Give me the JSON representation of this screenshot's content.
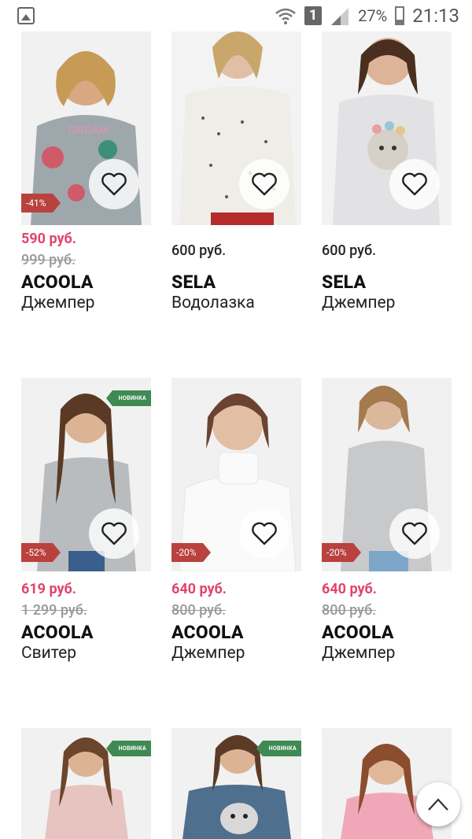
{
  "status_bar": {
    "battery": "27%",
    "time": "21:13",
    "sim": "1"
  },
  "products": [
    {
      "price": "590 руб.",
      "old_price": "999 руб.",
      "brand": "ACOOLA",
      "name": "Джемпер",
      "discount": "-41%",
      "badge": "",
      "sale": true
    },
    {
      "price": "600 руб.",
      "old_price": "",
      "brand": "SELA",
      "name": "Водолазка",
      "discount": "",
      "badge": "",
      "sale": false
    },
    {
      "price": "600 руб.",
      "old_price": "",
      "brand": "SELA",
      "name": "Джемпер",
      "discount": "",
      "badge": "",
      "sale": false
    },
    {
      "price": "619 руб.",
      "old_price": "1 299 руб.",
      "brand": "ACOOLA",
      "name": "Свитер",
      "discount": "-52%",
      "badge": "НОВИНКА",
      "sale": true
    },
    {
      "price": "640 руб.",
      "old_price": "800 руб.",
      "brand": "ACOOLA",
      "name": "Джемпер",
      "discount": "-20%",
      "badge": "",
      "sale": true
    },
    {
      "price": "640 руб.",
      "old_price": "800 руб.",
      "brand": "ACOOLA",
      "name": "Джемпер",
      "discount": "-20%",
      "badge": "",
      "sale": true
    },
    {
      "badge": "НОВИНКА"
    },
    {
      "badge": "НОВИНКА"
    },
    {
      "badge": ""
    }
  ],
  "colors": {
    "sale": "#e0456d",
    "discount_badge": "#b9423e",
    "new_badge": "#3f8a53"
  }
}
